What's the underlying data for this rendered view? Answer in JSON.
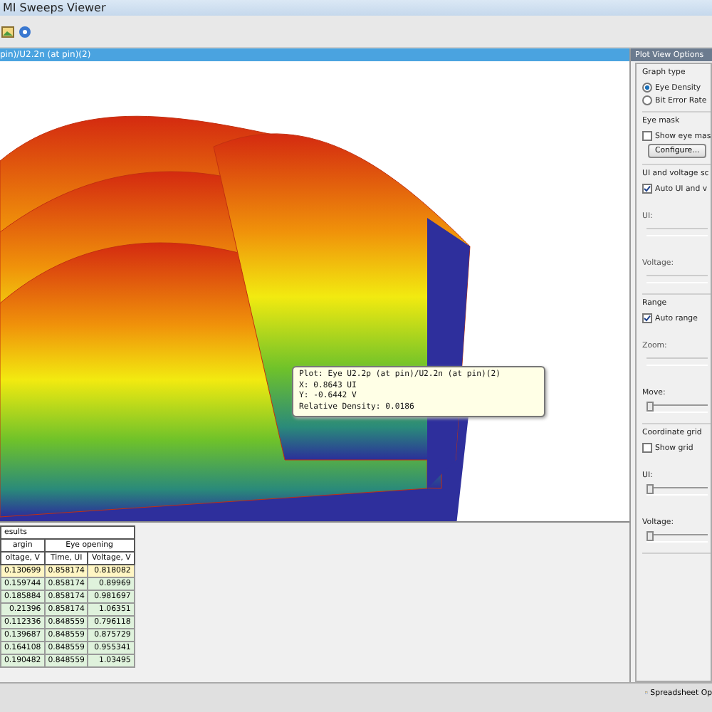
{
  "window": {
    "title": "MI Sweeps Viewer"
  },
  "plot_tab": {
    "title": "pin)/U2.2n (at pin)(2)"
  },
  "tooltip": {
    "lines": [
      "Plot: Eye U2.2p (at pin)/U2.2n (at pin)(2)",
      "X: 0.8643 UI",
      "Y: -0.6442 V",
      "Relative Density: 0.0186"
    ]
  },
  "results": {
    "title": "esults",
    "groups": [
      "argin",
      "Eye opening"
    ],
    "columns": [
      "oltage, V",
      "Time, UI",
      "Voltage, V"
    ],
    "rows": [
      {
        "cells": [
          "0.130699",
          "0.858174",
          "0.818082"
        ],
        "selected": true
      },
      {
        "cells": [
          "0.159744",
          "0.858174",
          "0.89969"
        ],
        "selected": false
      },
      {
        "cells": [
          "0.185884",
          "0.858174",
          "0.981697"
        ],
        "selected": false
      },
      {
        "cells": [
          "0.21396",
          "0.858174",
          "1.06351"
        ],
        "selected": false
      },
      {
        "cells": [
          "0.112336",
          "0.848559",
          "0.796118"
        ],
        "selected": false
      },
      {
        "cells": [
          "0.139687",
          "0.848559",
          "0.875729"
        ],
        "selected": false
      },
      {
        "cells": [
          "0.164108",
          "0.848559",
          "0.955341"
        ],
        "selected": false
      },
      {
        "cells": [
          "0.190482",
          "0.848559",
          "1.03495"
        ],
        "selected": false
      }
    ]
  },
  "options_panel": {
    "title": "Plot View Options",
    "sections": [
      {
        "title": "Graph type",
        "items": [
          {
            "kind": "radio",
            "label": "Eye Density",
            "selected": true
          },
          {
            "kind": "radio",
            "label": "Bit Error Rate",
            "selected": false
          }
        ]
      },
      {
        "title": "Eye mask",
        "items": [
          {
            "kind": "checkbox",
            "label": "Show eye mas",
            "checked": false
          },
          {
            "kind": "button",
            "label": "Configure..."
          }
        ]
      },
      {
        "title": "UI and voltage sc",
        "items": [
          {
            "kind": "checkbox",
            "label": "Auto UI and v",
            "checked": true
          },
          {
            "kind": "slider",
            "label": "UI:",
            "disabled": true,
            "level": 0.5
          },
          {
            "kind": "slider",
            "label": "Voltage:",
            "disabled": true,
            "level": 0.5
          }
        ]
      },
      {
        "title": "Range",
        "items": [
          {
            "kind": "checkbox",
            "label": "Auto range",
            "checked": true
          },
          {
            "kind": "slider",
            "label": "Zoom:",
            "disabled": true,
            "level": 0.5
          },
          {
            "kind": "slider",
            "label": "Move:",
            "disabled": false,
            "level": 0
          }
        ]
      },
      {
        "title": "Coordinate grid",
        "items": [
          {
            "kind": "checkbox",
            "label": "Show grid",
            "checked": false
          },
          {
            "kind": "slider",
            "label": "UI:",
            "disabled": false,
            "level": 0
          },
          {
            "kind": "slider",
            "label": "Voltage:",
            "disabled": false,
            "level": 0
          }
        ]
      }
    ]
  },
  "status_bar": {
    "tab": "Spreadsheet Op"
  }
}
